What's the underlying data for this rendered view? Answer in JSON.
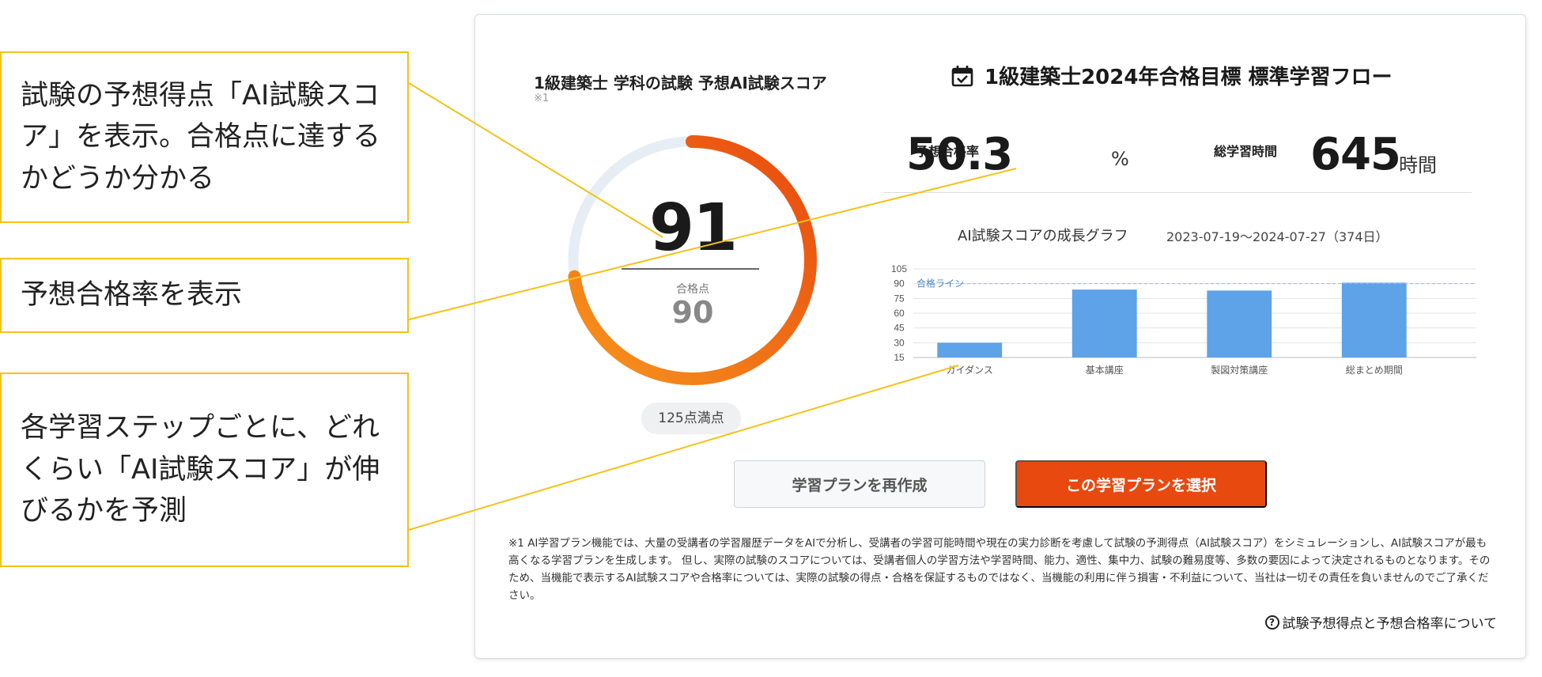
{
  "callouts": [
    "試験の予想得点「AI試験スコア」を表示。合格点に達するかどうか分かる",
    "予想合格率を表示",
    "各学習ステップごとに、どれくらい「AI試験スコア」が伸びるかを予測"
  ],
  "score_panel": {
    "title": "1級建築士 学科の試験 予想AI試験スコア",
    "note_mark": "※1",
    "score": "91",
    "pass_label": "合格点",
    "pass_score": "90",
    "full_score_badge": "125点満点",
    "gauge": {
      "value": 91,
      "max": 125,
      "track_color": "#e6edf5",
      "start_color": "#f7941d",
      "end_color": "#e8490f"
    }
  },
  "flow": {
    "title": "1級建築士2024年合格目標 標準学習フロー",
    "icon": "calendar-check-icon",
    "pass_rate_label": "予想合格率",
    "pass_rate_value": "50.3",
    "pass_rate_unit": "%",
    "hours_label": "総学習時間",
    "hours_value": "645",
    "hours_unit": "時間",
    "graph_title": "AI試験スコアの成長グラフ",
    "graph_range": "2023-07-19～2024-07-27（374日）"
  },
  "chart_data": {
    "type": "bar",
    "categories": [
      "ガイダンス",
      "基本講座",
      "製図対策講座",
      "総まとめ期間"
    ],
    "values": [
      30,
      84,
      83,
      91
    ],
    "yticks": [
      15,
      30,
      45,
      60,
      75,
      90,
      105
    ],
    "ylim": [
      15,
      105
    ],
    "reference_line": {
      "value": 90,
      "label": "合格ライン"
    },
    "bar_color": "#5ea2e8",
    "grid": true
  },
  "buttons": {
    "recreate": "学習プランを再作成",
    "select": "この学習プランを選択"
  },
  "disclaimer": "※1 AI学習プラン機能では、大量の受講者の学習履歴データをAIで分析し、受講者の学習可能時間や現在の実力診断を考慮して試験の予測得点（AI試験スコア）をシミュレーションし、AI試験スコアが最も高くなる学習プランを生成します。 但し、実際の試験のスコアについては、受講者個人の学習方法や学習時間、能力、適性、集中力、試験の難易度等、多数の要因によって決定されるものとなります。そのため、当機能で表示するAI試験スコアや合格率については、実際の試験の得点・合格を保証するものではなく、当機能の利用に伴う損害・不利益について、当社は一切その責任を負いませんのでご了承ください。",
  "help_link": {
    "icon": "question-circle-icon",
    "label": "試験予想得点と予想合格率について"
  },
  "colors": {
    "callout_border": "#f2c21a",
    "accent": "#e8490f",
    "bar": "#5ea2e8"
  }
}
